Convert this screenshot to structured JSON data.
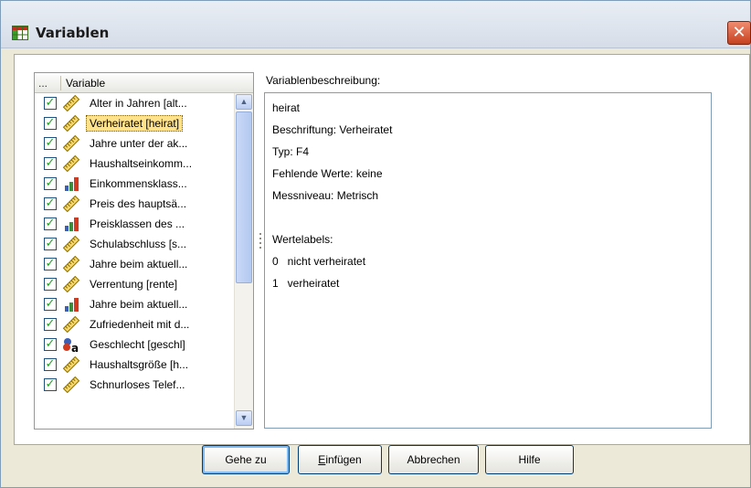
{
  "window": {
    "title": "Variablen",
    "close_glyph": "✕"
  },
  "variable_list": {
    "header_dots": "...",
    "header_label": "Variable",
    "items": [
      {
        "label": "Alter in Jahren [alt...",
        "icon": "scale-icon",
        "checked": true
      },
      {
        "label": "Verheiratet [heirat]",
        "icon": "scale-icon",
        "checked": true,
        "selected": true
      },
      {
        "label": "Jahre unter der ak...",
        "icon": "scale-icon",
        "checked": true
      },
      {
        "label": "Haushaltseinkomm...",
        "icon": "scale-icon",
        "checked": true
      },
      {
        "label": "Einkommensklass...",
        "icon": "ordinal-icon",
        "checked": true
      },
      {
        "label": "Preis des hauptsä...",
        "icon": "scale-icon",
        "checked": true
      },
      {
        "label": "Preisklassen des ...",
        "icon": "ordinal-icon",
        "checked": true
      },
      {
        "label": "Schulabschluss [s...",
        "icon": "scale-icon",
        "checked": true
      },
      {
        "label": "Jahre beim aktuell...",
        "icon": "scale-icon",
        "checked": true
      },
      {
        "label": "Verrentung [rente]",
        "icon": "scale-icon",
        "checked": true
      },
      {
        "label": "Jahre beim aktuell...",
        "icon": "ordinal-icon",
        "checked": true
      },
      {
        "label": "Zufriedenheit mit d...",
        "icon": "scale-icon",
        "checked": true
      },
      {
        "label": "Geschlecht [geschl]",
        "icon": "nominal-string-icon",
        "checked": true
      },
      {
        "label": "Haushaltsgröße [h...",
        "icon": "scale-icon",
        "checked": true
      },
      {
        "label": "Schnurloses Telef...",
        "icon": "scale-icon",
        "checked": true
      }
    ]
  },
  "description": {
    "title": "Variablenbeschreibung:",
    "lines": {
      "name": "heirat",
      "label": "Beschriftung:  Verheiratet",
      "type": "Typ:  F4",
      "missing": "Fehlende Werte:  keine",
      "measure": "Messniveau:  Metrisch",
      "value_labels_title": "Wertelabels:",
      "value_0": "0   nicht verheiratet",
      "value_1": "1   verheiratet"
    }
  },
  "buttons": {
    "goto": "Gehe zu",
    "insert_mnemonic": "E",
    "insert_rest": "infügen",
    "cancel": "Abbrechen",
    "help": "Hilfe"
  },
  "colors": {
    "selection": "#ffe28a",
    "checkmark": "#21a121",
    "border": "#7f9db9"
  }
}
